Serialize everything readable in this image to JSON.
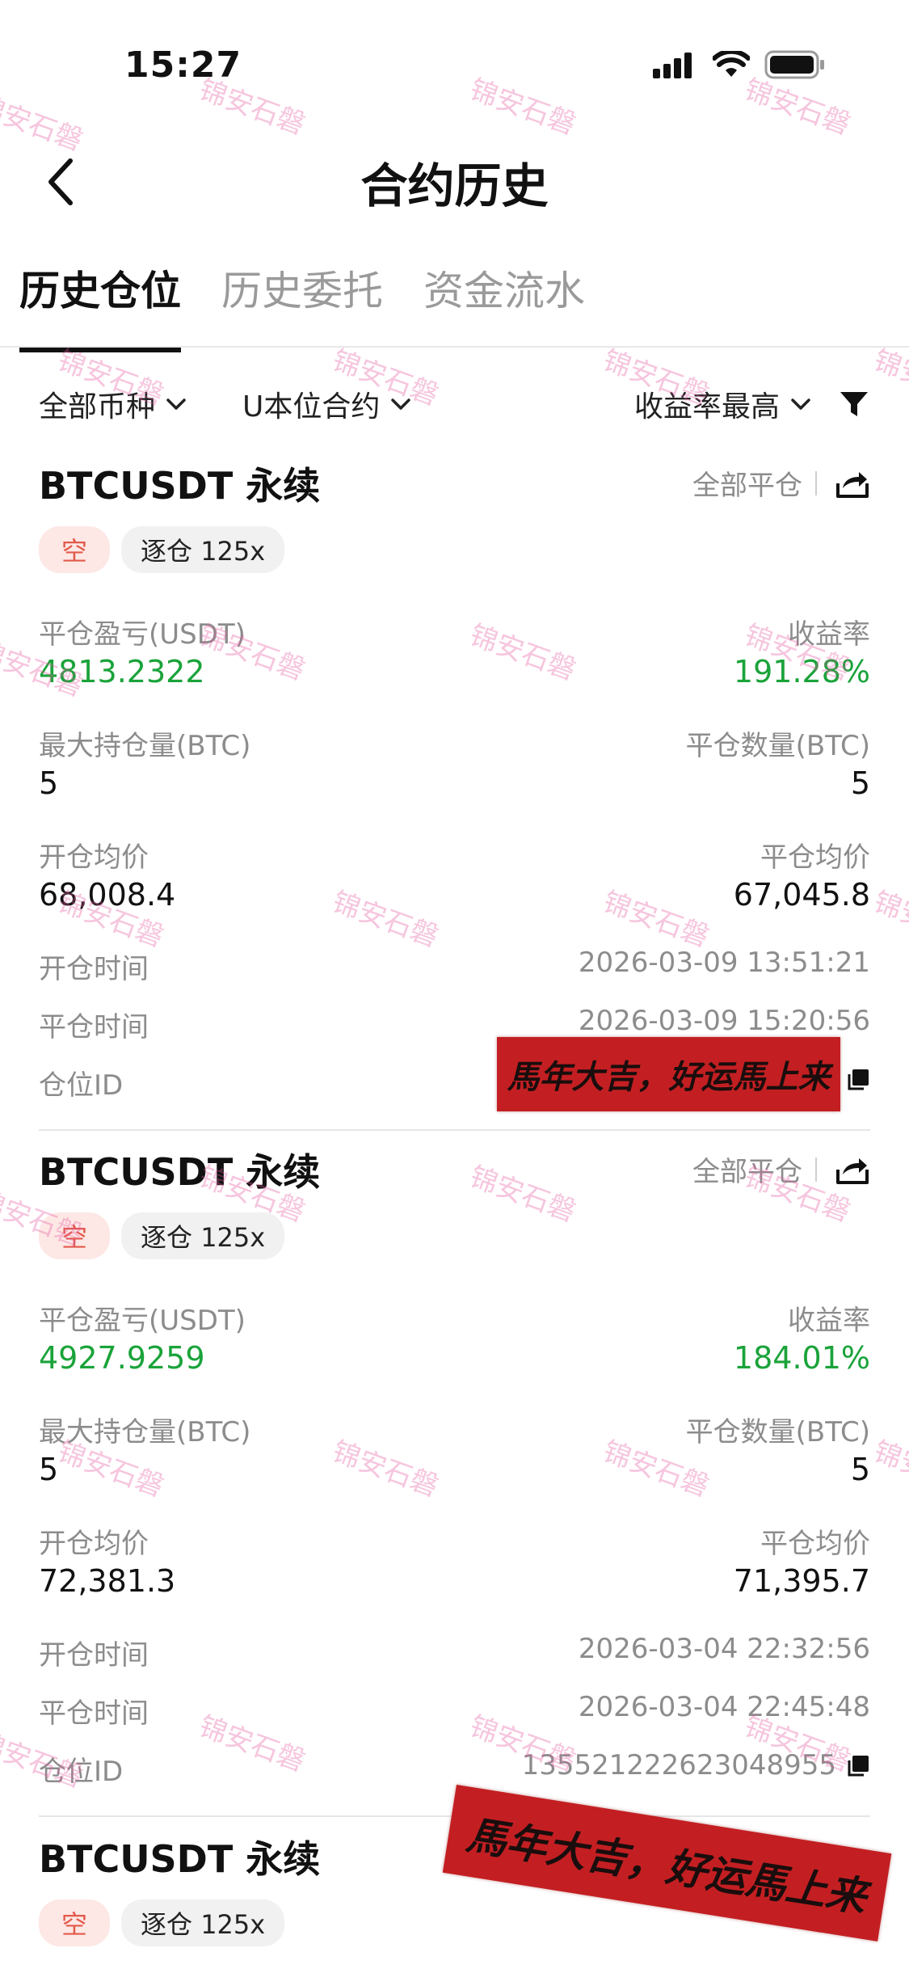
{
  "status_bar": {
    "time": "15:27"
  },
  "header": {
    "title": "合约历史"
  },
  "tabs": [
    {
      "label": "历史仓位"
    },
    {
      "label": "历史委托"
    },
    {
      "label": "资金流水"
    }
  ],
  "filters": {
    "coin": "全部币种",
    "contract": "U本位合约",
    "sort": "收益率最高"
  },
  "labels": {
    "close_all": "全部平仓",
    "pnl": "平仓盈亏(USDT)",
    "yield": "收益率",
    "max_position": "最大持仓量(BTC)",
    "close_qty": "平仓数量(BTC)",
    "open_avg": "开仓均价",
    "close_avg": "平仓均价",
    "open_time": "开仓时间",
    "close_time": "平仓时间",
    "position_id": "仓位ID"
  },
  "positions": [
    {
      "symbol": "BTCUSDT 永续",
      "side": "空",
      "margin": "逐仓 125x",
      "pnl": "4813.2322",
      "yield": "191.28%",
      "max_position": "5",
      "close_qty": "5",
      "open_avg": "68,008.4",
      "close_avg": "67,045.8",
      "open_time": "2026-03-09 13:51:21",
      "close_time": "2026-03-09 15:20:56",
      "position_id": ""
    },
    {
      "symbol": "BTCUSDT 永续",
      "side": "空",
      "margin": "逐仓 125x",
      "pnl": "4927.9259",
      "yield": "184.01%",
      "max_position": "5",
      "close_qty": "5",
      "open_avg": "72,381.3",
      "close_avg": "71,395.7",
      "open_time": "2026-03-04 22:32:56",
      "close_time": "2026-03-04 22:45:48",
      "position_id": "1355212226230489​55"
    },
    {
      "symbol": "BTCUSDT 永续",
      "side": "空",
      "margin": "逐仓 125x"
    }
  ],
  "stickers": {
    "text": "馬年大吉，好运馬上来"
  },
  "watermark": {
    "text": "锦安石磐"
  },
  "colors": {
    "profit": "#1aa33a",
    "short_badge": "#e25a4c",
    "sticker": "#c31f22"
  }
}
